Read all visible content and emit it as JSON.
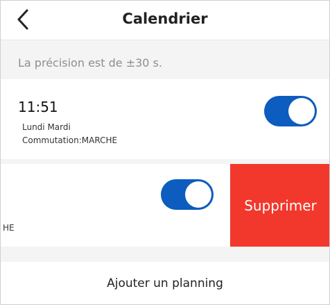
{
  "header": {
    "title": "Calendrier",
    "back_icon": "chevron-left-icon"
  },
  "notice": {
    "precision_text": "La précision est de ±30 s."
  },
  "schedules": [
    {
      "time": "11:51",
      "days": "Lundi Mardi",
      "switch_state": "Commutation:MARCHE",
      "enabled": true
    },
    {
      "visible_fragment": "HE",
      "enabled": true
    }
  ],
  "swipe_action": {
    "delete_label": "Supprimer"
  },
  "footer": {
    "add_label": "Ajouter un planning"
  },
  "colors": {
    "toggle_on": "#0d5cbf",
    "delete": "#f2382c",
    "background": "#f4f4f4"
  }
}
